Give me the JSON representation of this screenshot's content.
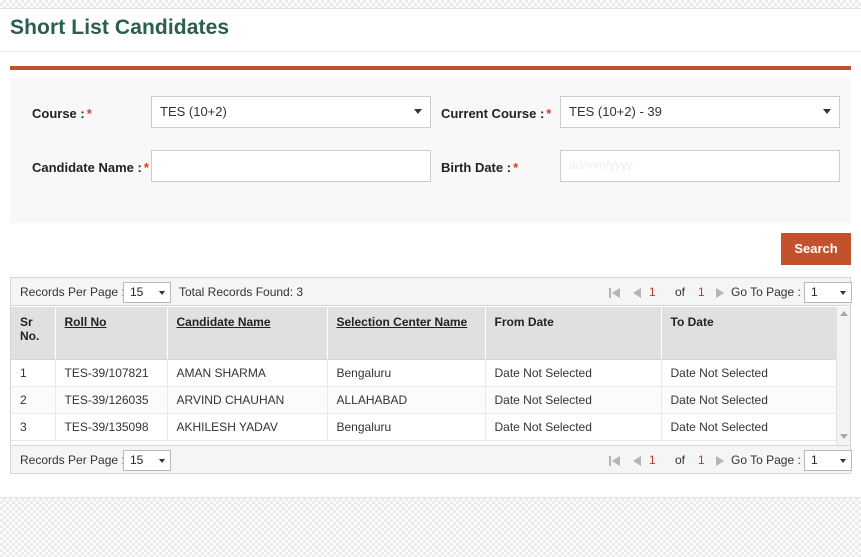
{
  "page": {
    "title": "Short List Candidates",
    "accent_color": "#c4512e",
    "title_color": "#2b5d50"
  },
  "form": {
    "course": {
      "label": "Course :",
      "required_marker": "*",
      "value": "TES (10+2)"
    },
    "current_course": {
      "label": "Current Course :",
      "required_marker": "*",
      "value": "TES (10+2) - 39"
    },
    "candidate_name": {
      "label": "Candidate Name :",
      "required_marker": "*",
      "value": "",
      "placeholder": ""
    },
    "birth_date": {
      "label": "Birth Date :",
      "required_marker": "*",
      "value": "",
      "placeholder": "dd/mm/yyyy"
    },
    "search_button": "Search"
  },
  "pager": {
    "records_per_page_label": "Records Per Page :",
    "records_per_page_value": "15",
    "total_records_label": "Total Records Found: 3",
    "first_icon": "first-page-icon",
    "prev_icon": "previous-page-icon",
    "next_icon": "next-page-icon",
    "current_page": "1",
    "of_label": "of",
    "total_pages": "1",
    "go_to_page_label": "Go To Page :",
    "go_to_page_value": "1"
  },
  "table": {
    "columns": [
      {
        "label": "Sr No.",
        "sortable": false
      },
      {
        "label": "Roll No",
        "sortable": true
      },
      {
        "label": "Candidate Name",
        "sortable": true
      },
      {
        "label": "Selection Center Name",
        "sortable": true
      },
      {
        "label": "From Date",
        "sortable": false
      },
      {
        "label": "To Date",
        "sortable": false
      }
    ],
    "rows": [
      {
        "sr": "1",
        "roll_no": "TES-39/107821",
        "candidate_name": "AMAN SHARMA",
        "selection_center": "Bengaluru",
        "from_date": "Date Not Selected",
        "to_date": "Date Not Selected"
      },
      {
        "sr": "2",
        "roll_no": "TES-39/126035",
        "candidate_name": "ARVIND CHAUHAN",
        "selection_center": "ALLAHABAD",
        "from_date": "Date Not Selected",
        "to_date": "Date Not Selected"
      },
      {
        "sr": "3",
        "roll_no": "TES-39/135098",
        "candidate_name": "AKHILESH YADAV",
        "selection_center": "Bengaluru",
        "from_date": "Date Not Selected",
        "to_date": "Date Not Selected"
      }
    ]
  }
}
